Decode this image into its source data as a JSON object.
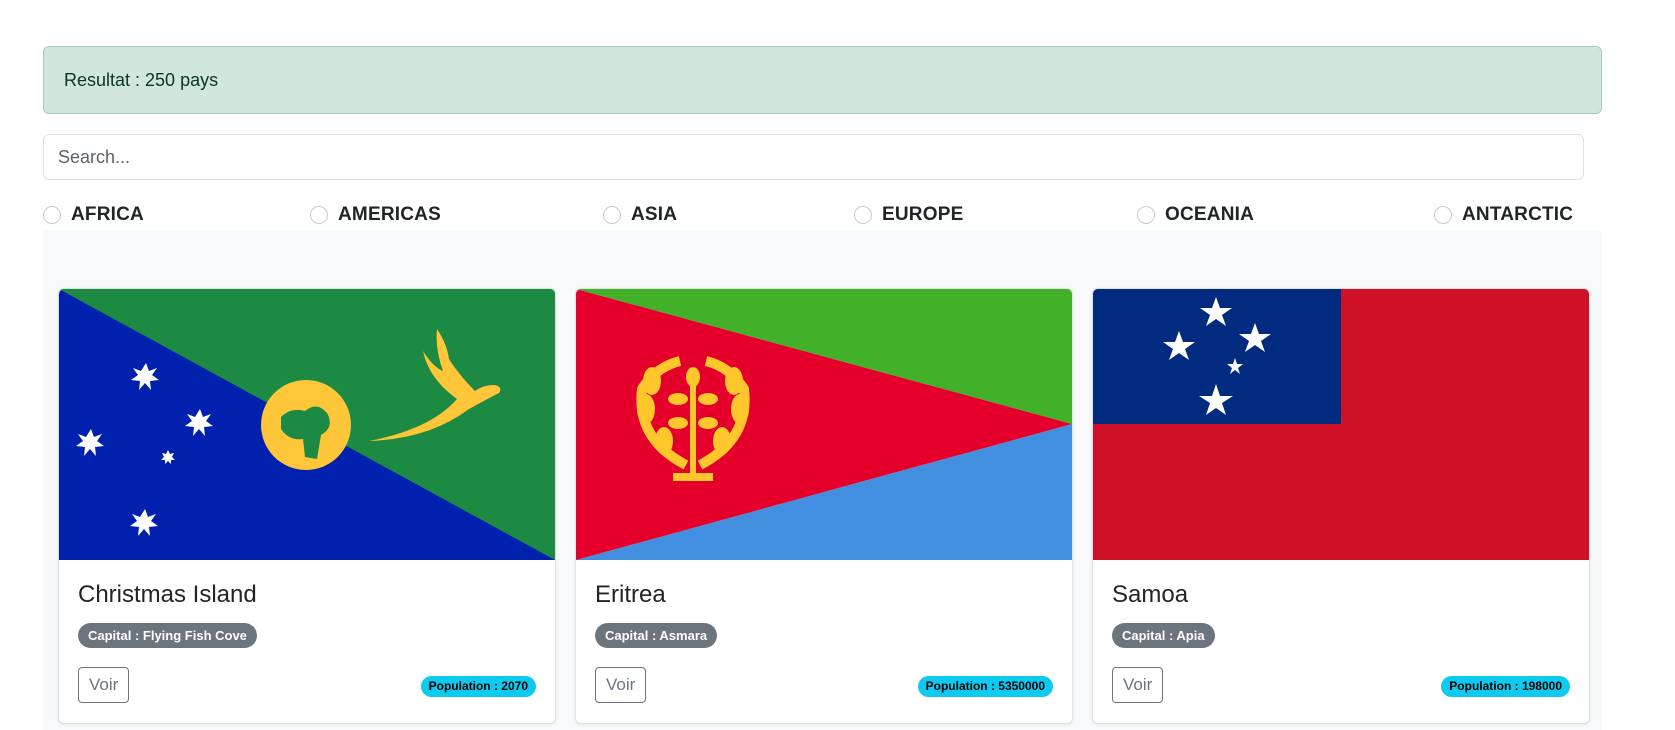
{
  "result": {
    "text": "Resultat : 250 pays"
  },
  "search": {
    "placeholder": "Search...",
    "value": ""
  },
  "regions": [
    "AFRICA",
    "AMERICAS",
    "ASIA",
    "EUROPE",
    "OCEANIA",
    "ANTARCTIC"
  ],
  "countries": [
    {
      "name": "Christmas Island",
      "capital": "Capital : Flying Fish Cove",
      "button": "Voir",
      "population": "Population : 2070",
      "flag_icon": "christmas-island-flag"
    },
    {
      "name": "Eritrea",
      "capital": "Capital : Asmara",
      "button": "Voir",
      "population": "Population : 5350000",
      "flag_icon": "eritrea-flag"
    },
    {
      "name": "Samoa",
      "capital": "Capital : Apia",
      "button": "Voir",
      "population": "Population : 198000",
      "flag_icon": "samoa-flag"
    }
  ],
  "colors": {
    "alert_bg": "#d1e7dd",
    "badge_secondary": "#6c757d",
    "badge_info": "#0dcaf0"
  }
}
